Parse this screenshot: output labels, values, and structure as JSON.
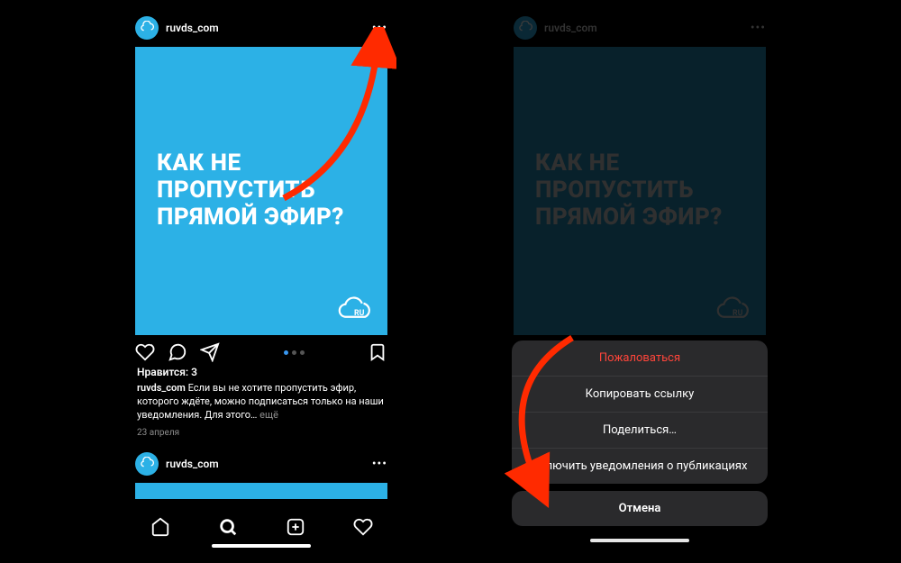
{
  "post": {
    "username": "ruvds_com",
    "card_title": "КАК НЕ ПРОПУСТИТЬ ПРЯМОЙ ЭФИР?",
    "likes_label": "Нравится: 3",
    "caption_user": "ruvds_com",
    "caption_text": "Если вы не хотите пропустить эфир, которого ждёте, можно подписаться только на наши уведомления. Для этого…",
    "more_label": "ещё",
    "date": "23 апреля"
  },
  "sheet": {
    "report": "Пожаловаться",
    "copy_link": "Копировать ссылку",
    "share": "Поделиться…",
    "enable_notifications": "Включить уведомления о публикациях",
    "cancel": "Отмена"
  },
  "icons": {
    "more": "more-icon",
    "heart": "heart-icon",
    "comment": "comment-icon",
    "send": "send-icon",
    "bookmark": "bookmark-icon",
    "home": "home-icon",
    "search": "search-icon",
    "add": "add-icon",
    "activity": "activity-icon"
  },
  "colors": {
    "brand_blue": "#2cb1e6",
    "accent": "#3897f0",
    "danger": "#ff453a"
  }
}
